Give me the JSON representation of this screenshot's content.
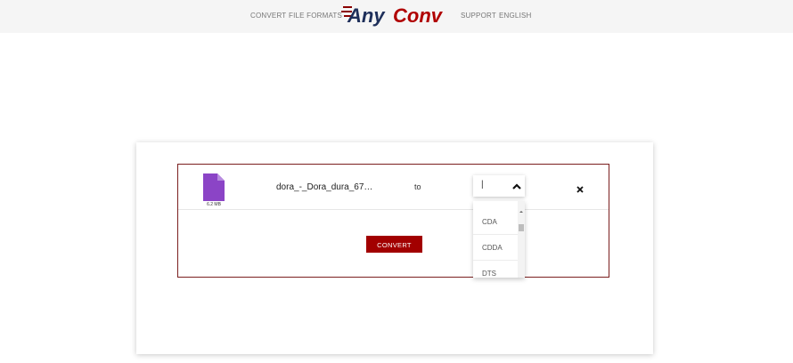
{
  "header": {
    "nav_left": [
      "CONVERT",
      "FILE FORMATS"
    ],
    "nav_right": [
      "SUPPORT",
      "ENGLISH"
    ],
    "logo_text_left": "Any",
    "logo_text_right": "Conv"
  },
  "file": {
    "name": "dora_-_Dora_dura_67…",
    "size": "6.2 MB",
    "to_label": "to"
  },
  "format_select": {
    "value": "|",
    "options": [
      "CDA",
      "CDDA",
      "DTS"
    ]
  },
  "convert_button": {
    "label": "CONVERT"
  },
  "colors": {
    "brand_red": "#a20000",
    "brand_navy": "#1e2f5a",
    "file_icon": "#8b44c6"
  },
  "icons": {
    "close": "close-icon",
    "chevron": "chevron-up-icon",
    "file": "file-icon"
  }
}
